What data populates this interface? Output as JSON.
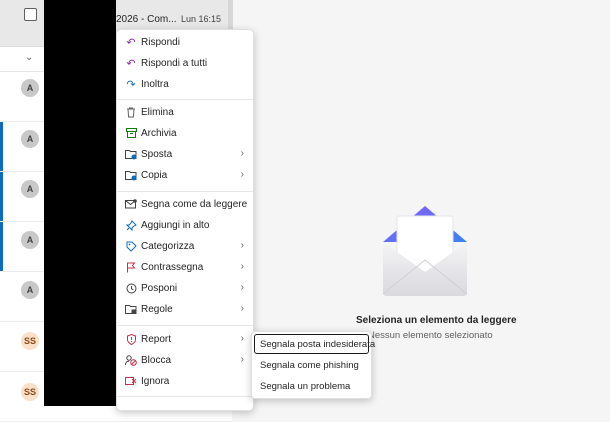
{
  "list": {
    "header_subject": "2026 - Com...",
    "header_time": "Lun 16:15",
    "rows": [
      {
        "initials": "A",
        "unread": false
      },
      {
        "initials": "A",
        "unread": true
      },
      {
        "initials": "A",
        "unread": true
      },
      {
        "initials": "A",
        "unread": true
      },
      {
        "initials": "A",
        "unread": false
      },
      {
        "initials": "SS",
        "unread": false
      },
      {
        "initials": "SS",
        "unread": false
      }
    ]
  },
  "context_menu": {
    "items": [
      {
        "label": "Rispondi",
        "icon": "reply-icon",
        "color": "#8b2aa7"
      },
      {
        "label": "Rispondi a tutti",
        "icon": "reply-all-icon",
        "color": "#8b2aa7"
      },
      {
        "label": "Inoltra",
        "icon": "forward-icon",
        "color": "#0f6cbd"
      },
      {
        "label": "Elimina",
        "icon": "trash-icon",
        "color": "#616161"
      },
      {
        "label": "Archivia",
        "icon": "archive-icon",
        "color": "#107c10"
      },
      {
        "label": "Sposta",
        "icon": "move-folder-icon",
        "color": "#0f6cbd"
      },
      {
        "label": "Copia",
        "icon": "copy-icon",
        "color": "#0f6cbd"
      },
      {
        "label": "Segna come da leggere",
        "icon": "mark-unread-icon",
        "color": "#424242"
      },
      {
        "label": "Aggiungi in alto",
        "icon": "pin-icon",
        "color": "#0f6cbd"
      },
      {
        "label": "Categorizza",
        "icon": "tag-icon",
        "color": "#0f6cbd"
      },
      {
        "label": "Contrassegna",
        "icon": "flag-icon",
        "color": "#c4314b"
      },
      {
        "label": "Posponi",
        "icon": "clock-icon",
        "color": "#424242"
      },
      {
        "label": "Regole",
        "icon": "rules-icon",
        "color": "#424242"
      },
      {
        "label": "Report",
        "icon": "report-icon",
        "color": "#c4314b"
      },
      {
        "label": "Blocca",
        "icon": "block-icon",
        "color": "#c4314b"
      },
      {
        "label": "Ignora",
        "icon": "ignore-icon",
        "color": "#c4314b"
      }
    ]
  },
  "report_submenu": {
    "items": [
      {
        "label": "Segnala posta indesiderata",
        "focused": true
      },
      {
        "label": "Segnala come phishing"
      },
      {
        "label": "Segnala un problema"
      }
    ]
  },
  "reading_pane": {
    "empty_title": "Seleziona un elemento da leggere",
    "empty_subtitle": "Nessun elemento selezionato"
  },
  "colors": {
    "accent": "#0f6cbd",
    "envelope_purple": "#8a5cf6",
    "envelope_blue": "#3b82f6"
  }
}
